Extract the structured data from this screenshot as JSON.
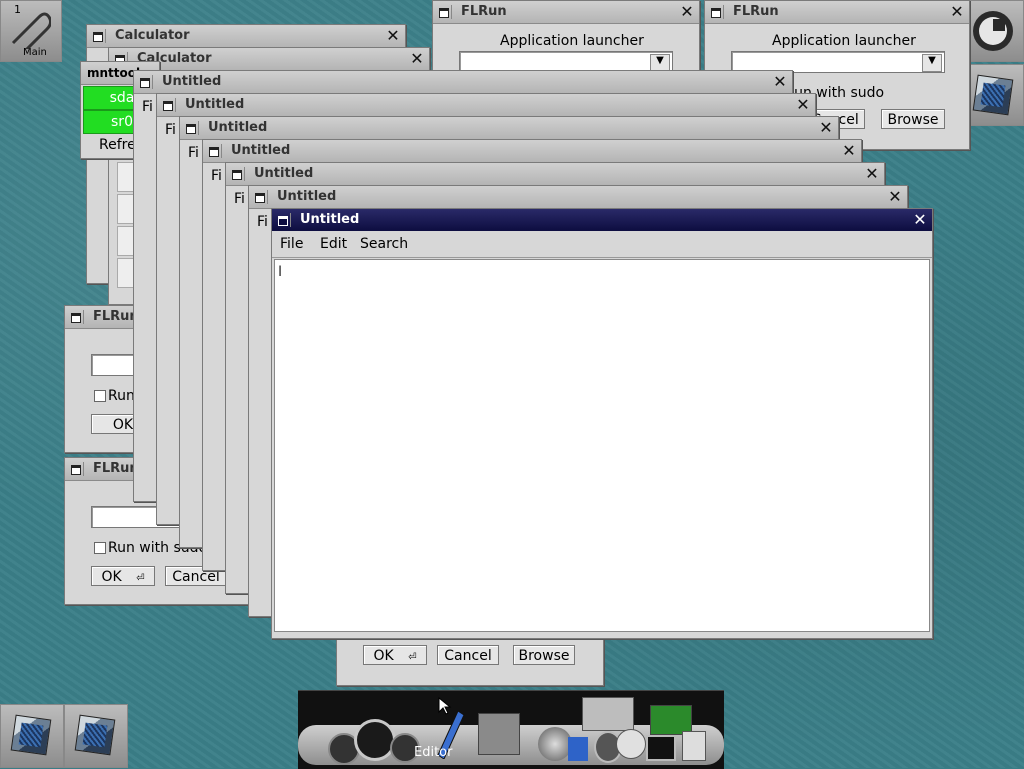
{
  "pager": {
    "number": "1",
    "label": "Main"
  },
  "calculator": {
    "title": "Calculator"
  },
  "mnttool": {
    "title": "mnttool",
    "items": [
      "sda",
      "sr0"
    ],
    "refresh_label": "Refres"
  },
  "flrun_windows": [
    {
      "title": "FLRun",
      "heading": "Application launcher",
      "run_with_sudo": "Run with sudo",
      "ok": "OK",
      "cancel": "Cancel",
      "browse": "Browse"
    }
  ],
  "flrun_left": {
    "title": "FLRun",
    "run_with_sudo": "Run with sudo",
    "ok": "OK",
    "cancel": "Cancel"
  },
  "flrun_bottom": {
    "ok": "OK",
    "cancel": "Cancel",
    "browse": "Browse"
  },
  "editor": {
    "title": "Untitled",
    "menu": {
      "file": "File",
      "edit": "Edit",
      "search": "Search"
    },
    "stacked_menu_stub": "Fi"
  },
  "dock": {
    "tooltip": "Editor"
  },
  "colors": {
    "active_titlebar": "#0d0d40",
    "mount_green": "#22dd22",
    "desktop": "#3b7f88"
  }
}
